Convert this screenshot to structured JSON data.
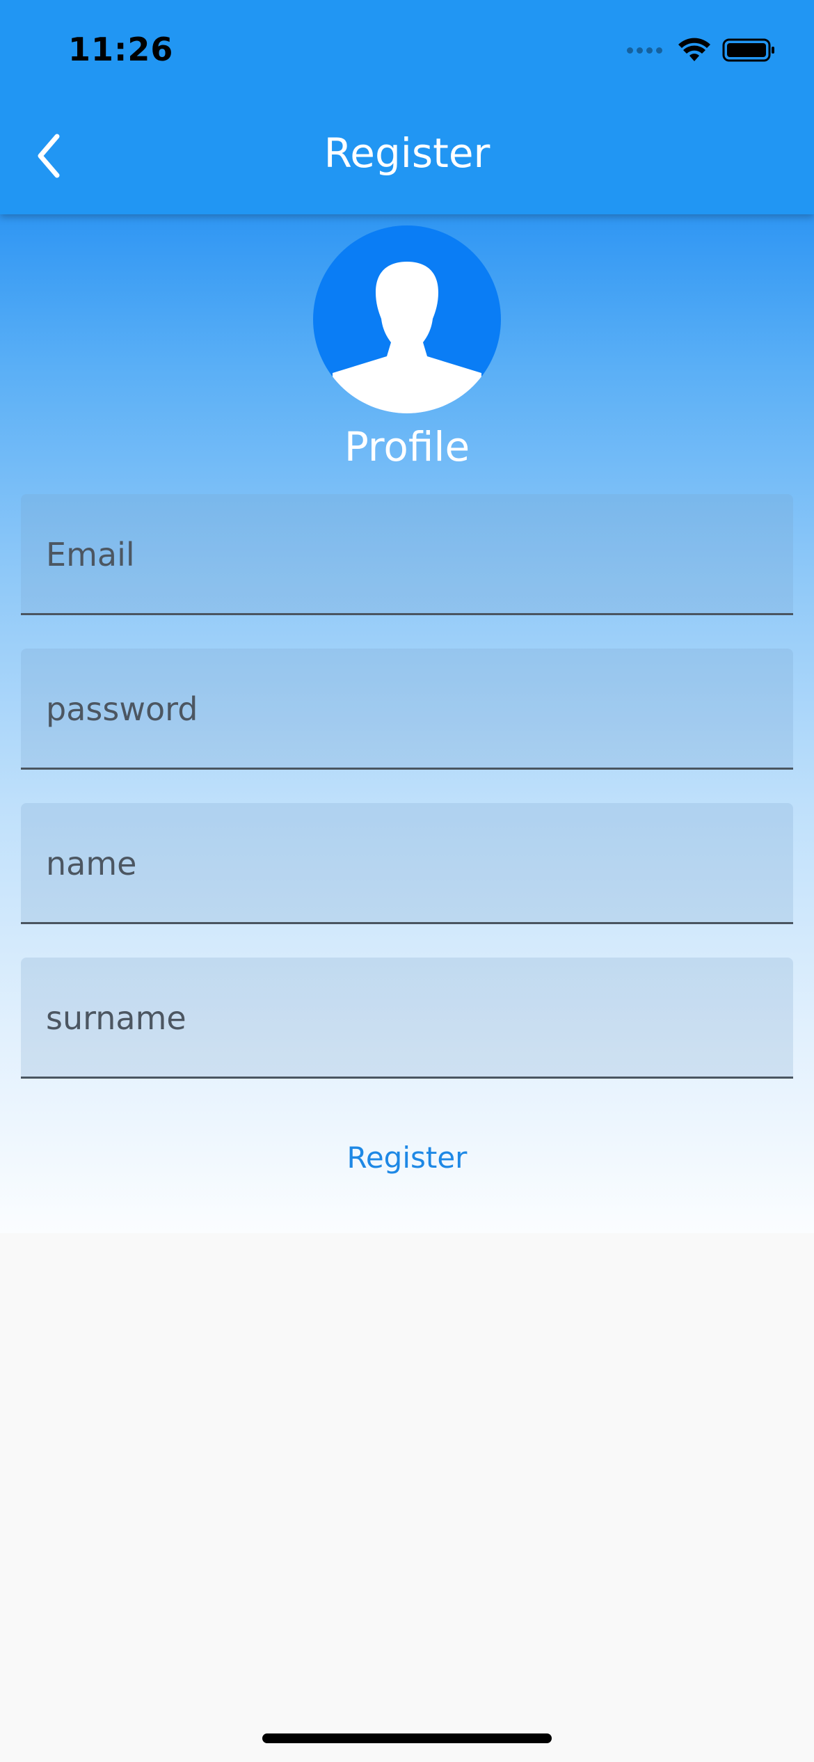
{
  "status_bar": {
    "time": "11:26"
  },
  "app_bar": {
    "title": "Register",
    "back_icon": "chevron-left-icon"
  },
  "profile": {
    "avatar_icon": "user-silhouette-icon",
    "label": "Profile"
  },
  "form": {
    "fields": [
      {
        "placeholder": "Email",
        "value": ""
      },
      {
        "placeholder": "password",
        "value": ""
      },
      {
        "placeholder": "name",
        "value": ""
      },
      {
        "placeholder": "surname",
        "value": ""
      }
    ],
    "submit_label": "Register"
  },
  "colors": {
    "primary": "#2196f3",
    "avatar_bg": "#0a7df5",
    "link": "#1e88e5",
    "page_bg": "#f9f9f9"
  }
}
